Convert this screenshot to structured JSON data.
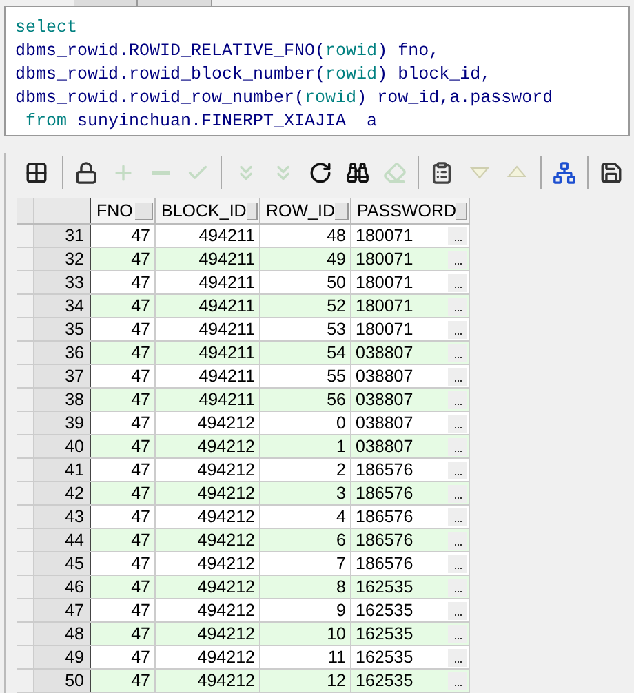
{
  "editor": {
    "lines": [
      [
        {
          "text": "select",
          "kind": "keyword"
        }
      ],
      [
        {
          "text": "dbms_rowid.ROWID_RELATIVE_FNO(",
          "kind": "ident"
        },
        {
          "text": "rowid",
          "kind": "keyword"
        },
        {
          "text": ") fno,",
          "kind": "ident"
        }
      ],
      [
        {
          "text": "dbms_rowid.rowid_block_number(",
          "kind": "ident"
        },
        {
          "text": "rowid",
          "kind": "keyword"
        },
        {
          "text": ") block_id,",
          "kind": "ident"
        }
      ],
      [
        {
          "text": "dbms_rowid.rowid_row_number(",
          "kind": "ident"
        },
        {
          "text": "rowid",
          "kind": "keyword"
        },
        {
          "text": ") row_id,a.password",
          "kind": "ident"
        }
      ],
      [
        {
          "text": " from",
          "kind": "keyword"
        },
        {
          "text": " sunyinchuan.FINERPT_XIAJIA  a",
          "kind": "ident"
        }
      ]
    ]
  },
  "toolbar": [
    {
      "kind": "grid",
      "disabled": false
    },
    {
      "kind": "sep"
    },
    {
      "kind": "lock",
      "disabled": false
    },
    {
      "kind": "plus",
      "disabled": true
    },
    {
      "kind": "minus",
      "disabled": true
    },
    {
      "kind": "check",
      "disabled": true
    },
    {
      "kind": "sep"
    },
    {
      "kind": "next",
      "disabled": true
    },
    {
      "kind": "last",
      "disabled": true
    },
    {
      "kind": "refresh",
      "disabled": false
    },
    {
      "kind": "find",
      "disabled": false
    },
    {
      "kind": "clear",
      "disabled": true
    },
    {
      "kind": "sep"
    },
    {
      "kind": "export",
      "disabled": false
    },
    {
      "kind": "down",
      "disabled": true
    },
    {
      "kind": "up",
      "disabled": true
    },
    {
      "kind": "sep"
    },
    {
      "kind": "tree",
      "disabled": false
    },
    {
      "kind": "sep"
    },
    {
      "kind": "save",
      "disabled": false
    }
  ],
  "table": {
    "columns": [
      "",
      "FNO",
      "BLOCK_ID",
      "ROW_ID",
      "PASSWORD"
    ],
    "rows": [
      [
        "31",
        "47",
        "494211",
        "48",
        "180071"
      ],
      [
        "32",
        "47",
        "494211",
        "49",
        "180071"
      ],
      [
        "33",
        "47",
        "494211",
        "50",
        "180071"
      ],
      [
        "34",
        "47",
        "494211",
        "52",
        "180071"
      ],
      [
        "35",
        "47",
        "494211",
        "53",
        "180071"
      ],
      [
        "36",
        "47",
        "494211",
        "54",
        "038807"
      ],
      [
        "37",
        "47",
        "494211",
        "55",
        "038807"
      ],
      [
        "38",
        "47",
        "494211",
        "56",
        "038807"
      ],
      [
        "39",
        "47",
        "494212",
        "0",
        "038807"
      ],
      [
        "40",
        "47",
        "494212",
        "1",
        "038807"
      ],
      [
        "41",
        "47",
        "494212",
        "2",
        "186576"
      ],
      [
        "42",
        "47",
        "494212",
        "3",
        "186576"
      ],
      [
        "43",
        "47",
        "494212",
        "4",
        "186576"
      ],
      [
        "44",
        "47",
        "494212",
        "6",
        "186576"
      ],
      [
        "45",
        "47",
        "494212",
        "7",
        "186576"
      ],
      [
        "46",
        "47",
        "494212",
        "8",
        "162535"
      ],
      [
        "47",
        "47",
        "494212",
        "9",
        "162535"
      ],
      [
        "48",
        "47",
        "494212",
        "10",
        "162535"
      ],
      [
        "49",
        "47",
        "494212",
        "11",
        "162535"
      ],
      [
        "50",
        "47",
        "494212",
        "12",
        "162535"
      ]
    ]
  }
}
